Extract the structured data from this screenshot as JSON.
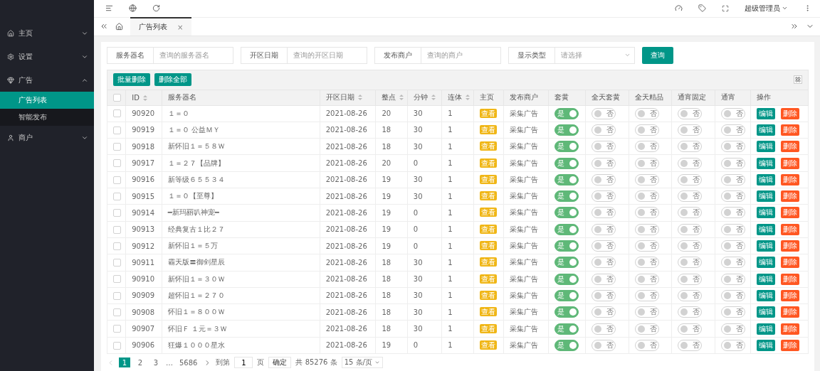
{
  "sidebar": {
    "items": [
      {
        "label": "主页",
        "expanded": false
      },
      {
        "label": "设置",
        "expanded": false
      },
      {
        "label": "广告",
        "expanded": true,
        "children": [
          {
            "label": "广告列表",
            "selected": true
          },
          {
            "label": "智能发布",
            "selected": false
          }
        ]
      },
      {
        "label": "商户",
        "expanded": false
      }
    ]
  },
  "topbar": {
    "user": "超级管理员"
  },
  "tabs": [
    {
      "label": "广告列表",
      "selected": true,
      "close": "×"
    }
  ],
  "filters": [
    {
      "label": "服务器名",
      "placeholder": "查询的服务器名",
      "kind": "input"
    },
    {
      "label": "开区日期",
      "placeholder": "查询的开区日期",
      "kind": "input"
    },
    {
      "label": "发布商户",
      "placeholder": "查询的商户",
      "kind": "input"
    },
    {
      "label": "显示类型",
      "placeholder": "请选择",
      "kind": "select"
    }
  ],
  "search_button": "查询",
  "toolbar": [
    "批量删除",
    "删除全部"
  ],
  "table": {
    "header_checked": false,
    "columns": [
      {
        "label": "ID",
        "sortable": true
      },
      {
        "label": "服务器名",
        "sortable": false
      },
      {
        "label": "开区日期",
        "sortable": true
      },
      {
        "label": "整点",
        "sortable": true
      },
      {
        "label": "分钟",
        "sortable": true
      },
      {
        "label": "连体",
        "sortable": true
      },
      {
        "label": "主页",
        "sortable": false
      },
      {
        "label": "发布商户",
        "sortable": false
      },
      {
        "label": "套黄",
        "sortable": false
      },
      {
        "label": "全天套黄",
        "sortable": false
      },
      {
        "label": "全天精品",
        "sortable": false
      },
      {
        "label": "通宵固定",
        "sortable": false
      },
      {
        "label": "通宵",
        "sortable": false
      },
      {
        "label": "操作",
        "sortable": false
      }
    ],
    "rows": [
      {
        "checked": false,
        "id": "90920",
        "name": "１＝０",
        "date": "2021-08-26",
        "hour": "20",
        "minute": "30",
        "link": "1",
        "home": "查看",
        "merchant": "采集广告",
        "toggles": [
          {
            "label": "是",
            "on": true
          },
          {
            "label": "否",
            "on": false
          },
          {
            "label": "否",
            "on": false
          },
          {
            "label": "否",
            "on": false
          },
          {
            "label": "否",
            "on": false
          }
        ],
        "actions": [
          "编辑",
          "删除"
        ]
      },
      {
        "checked": false,
        "id": "90919",
        "name": "１＝０ 公益ＭＹ",
        "date": "2021-08-26",
        "hour": "18",
        "minute": "30",
        "link": "1",
        "home": "查看",
        "merchant": "采集广告",
        "toggles": [
          {
            "label": "是",
            "on": true
          },
          {
            "label": "否",
            "on": false
          },
          {
            "label": "否",
            "on": false
          },
          {
            "label": "否",
            "on": false
          },
          {
            "label": "否",
            "on": false
          }
        ],
        "actions": [
          "编辑",
          "删除"
        ]
      },
      {
        "checked": false,
        "id": "90918",
        "name": "新怀旧１＝５８Ｗ",
        "date": "2021-08-26",
        "hour": "18",
        "minute": "30",
        "link": "1",
        "home": "查看",
        "merchant": "采集广告",
        "toggles": [
          {
            "label": "是",
            "on": true
          },
          {
            "label": "否",
            "on": false
          },
          {
            "label": "否",
            "on": false
          },
          {
            "label": "否",
            "on": false
          },
          {
            "label": "否",
            "on": false
          }
        ],
        "actions": [
          "编辑",
          "删除"
        ]
      },
      {
        "checked": false,
        "id": "90917",
        "name": "１＝２７【品牌】",
        "date": "2021-08-26",
        "hour": "20",
        "minute": "0",
        "link": "1",
        "home": "查看",
        "merchant": "采集广告",
        "toggles": [
          {
            "label": "是",
            "on": true
          },
          {
            "label": "否",
            "on": false
          },
          {
            "label": "否",
            "on": false
          },
          {
            "label": "否",
            "on": false
          },
          {
            "label": "否",
            "on": false
          }
        ],
        "actions": [
          "编辑",
          "删除"
        ]
      },
      {
        "checked": false,
        "id": "90916",
        "name": "新等级６５５３４",
        "date": "2021-08-26",
        "hour": "19",
        "minute": "30",
        "link": "1",
        "home": "查看",
        "merchant": "采集广告",
        "toggles": [
          {
            "label": "是",
            "on": true
          },
          {
            "label": "否",
            "on": false
          },
          {
            "label": "否",
            "on": false
          },
          {
            "label": "否",
            "on": false
          },
          {
            "label": "否",
            "on": false
          }
        ],
        "actions": [
          "编辑",
          "删除"
        ]
      },
      {
        "checked": false,
        "id": "90915",
        "name": "１＝０【至尊】",
        "date": "2021-08-26",
        "hour": "19",
        "minute": "30",
        "link": "1",
        "home": "查看",
        "merchant": "采集广告",
        "toggles": [
          {
            "label": "是",
            "on": true
          },
          {
            "label": "否",
            "on": false
          },
          {
            "label": "否",
            "on": false
          },
          {
            "label": "否",
            "on": false
          },
          {
            "label": "否",
            "on": false
          }
        ],
        "actions": [
          "编辑",
          "删除"
        ]
      },
      {
        "checked": false,
        "id": "90914",
        "name": "━新玛丽叭神宠━",
        "date": "2021-08-26",
        "hour": "19",
        "minute": "0",
        "link": "1",
        "home": "查看",
        "merchant": "采集广告",
        "toggles": [
          {
            "label": "是",
            "on": true
          },
          {
            "label": "否",
            "on": false
          },
          {
            "label": "否",
            "on": false
          },
          {
            "label": "否",
            "on": false
          },
          {
            "label": "否",
            "on": false
          }
        ],
        "actions": [
          "编辑",
          "删除"
        ]
      },
      {
        "checked": false,
        "id": "90913",
        "name": "经典复古１比２７",
        "date": "2021-08-26",
        "hour": "19",
        "minute": "0",
        "link": "1",
        "home": "查看",
        "merchant": "采集广告",
        "toggles": [
          {
            "label": "是",
            "on": true
          },
          {
            "label": "否",
            "on": false
          },
          {
            "label": "否",
            "on": false
          },
          {
            "label": "否",
            "on": false
          },
          {
            "label": "否",
            "on": false
          }
        ],
        "actions": [
          "编辑",
          "删除"
        ]
      },
      {
        "checked": false,
        "id": "90912",
        "name": "新怀旧１＝５万",
        "date": "2021-08-26",
        "hour": "19",
        "minute": "0",
        "link": "1",
        "home": "查看",
        "merchant": "采集广告",
        "toggles": [
          {
            "label": "是",
            "on": true
          },
          {
            "label": "否",
            "on": false
          },
          {
            "label": "否",
            "on": false
          },
          {
            "label": "否",
            "on": false
          },
          {
            "label": "否",
            "on": false
          }
        ],
        "actions": [
          "编辑",
          "删除"
        ]
      },
      {
        "checked": false,
        "id": "90911",
        "name": "霸天版〓御剑星辰",
        "date": "2021-08-26",
        "hour": "18",
        "minute": "30",
        "link": "1",
        "home": "查看",
        "merchant": "采集广告",
        "toggles": [
          {
            "label": "是",
            "on": true
          },
          {
            "label": "否",
            "on": false
          },
          {
            "label": "否",
            "on": false
          },
          {
            "label": "否",
            "on": false
          },
          {
            "label": "否",
            "on": false
          }
        ],
        "actions": [
          "编辑",
          "删除"
        ]
      },
      {
        "checked": false,
        "id": "90910",
        "name": "新怀旧１＝３０Ｗ",
        "date": "2021-08-26",
        "hour": "18",
        "minute": "30",
        "link": "1",
        "home": "查看",
        "merchant": "采集广告",
        "toggles": [
          {
            "label": "是",
            "on": true
          },
          {
            "label": "否",
            "on": false
          },
          {
            "label": "否",
            "on": false
          },
          {
            "label": "否",
            "on": false
          },
          {
            "label": "否",
            "on": false
          }
        ],
        "actions": [
          "编辑",
          "删除"
        ]
      },
      {
        "checked": false,
        "id": "90909",
        "name": "超怀旧１＝２７０",
        "date": "2021-08-26",
        "hour": "18",
        "minute": "30",
        "link": "1",
        "home": "查看",
        "merchant": "采集广告",
        "toggles": [
          {
            "label": "是",
            "on": true
          },
          {
            "label": "否",
            "on": false
          },
          {
            "label": "否",
            "on": false
          },
          {
            "label": "否",
            "on": false
          },
          {
            "label": "否",
            "on": false
          }
        ],
        "actions": [
          "编辑",
          "删除"
        ]
      },
      {
        "checked": false,
        "id": "90908",
        "name": "怀旧１＝８００Ｗ",
        "date": "2021-08-26",
        "hour": "18",
        "minute": "30",
        "link": "1",
        "home": "查看",
        "merchant": "采集广告",
        "toggles": [
          {
            "label": "是",
            "on": true
          },
          {
            "label": "否",
            "on": false
          },
          {
            "label": "否",
            "on": false
          },
          {
            "label": "否",
            "on": false
          },
          {
            "label": "否",
            "on": false
          }
        ],
        "actions": [
          "编辑",
          "删除"
        ]
      },
      {
        "checked": false,
        "id": "90907",
        "name": "怀旧Ｆ １元＝３Ｗ",
        "date": "2021-08-26",
        "hour": "18",
        "minute": "30",
        "link": "1",
        "home": "查看",
        "merchant": "采集广告",
        "toggles": [
          {
            "label": "是",
            "on": true
          },
          {
            "label": "否",
            "on": false
          },
          {
            "label": "否",
            "on": false
          },
          {
            "label": "否",
            "on": false
          },
          {
            "label": "否",
            "on": false
          }
        ],
        "actions": [
          "编辑",
          "删除"
        ]
      },
      {
        "checked": false,
        "id": "90906",
        "name": "狂爆１０００星水",
        "date": "2021-08-26",
        "hour": "19",
        "minute": "0",
        "link": "1",
        "home": "查看",
        "merchant": "采集广告",
        "toggles": [
          {
            "label": "是",
            "on": true
          },
          {
            "label": "否",
            "on": false
          },
          {
            "label": "否",
            "on": false
          },
          {
            "label": "否",
            "on": false
          },
          {
            "label": "否",
            "on": false
          }
        ],
        "actions": [
          "编辑",
          "删除"
        ]
      }
    ]
  },
  "pagination": {
    "pages": [
      {
        "label": "1",
        "selected": true
      },
      {
        "label": "2",
        "selected": false
      },
      {
        "label": "3",
        "selected": false
      }
    ],
    "ellipsis": "…",
    "last": "5686",
    "goto_label": "到第",
    "goto_value": "1",
    "page_unit": "页",
    "confirm": "确定",
    "total": "共 85276 条",
    "page_size": "15 条/页"
  }
}
